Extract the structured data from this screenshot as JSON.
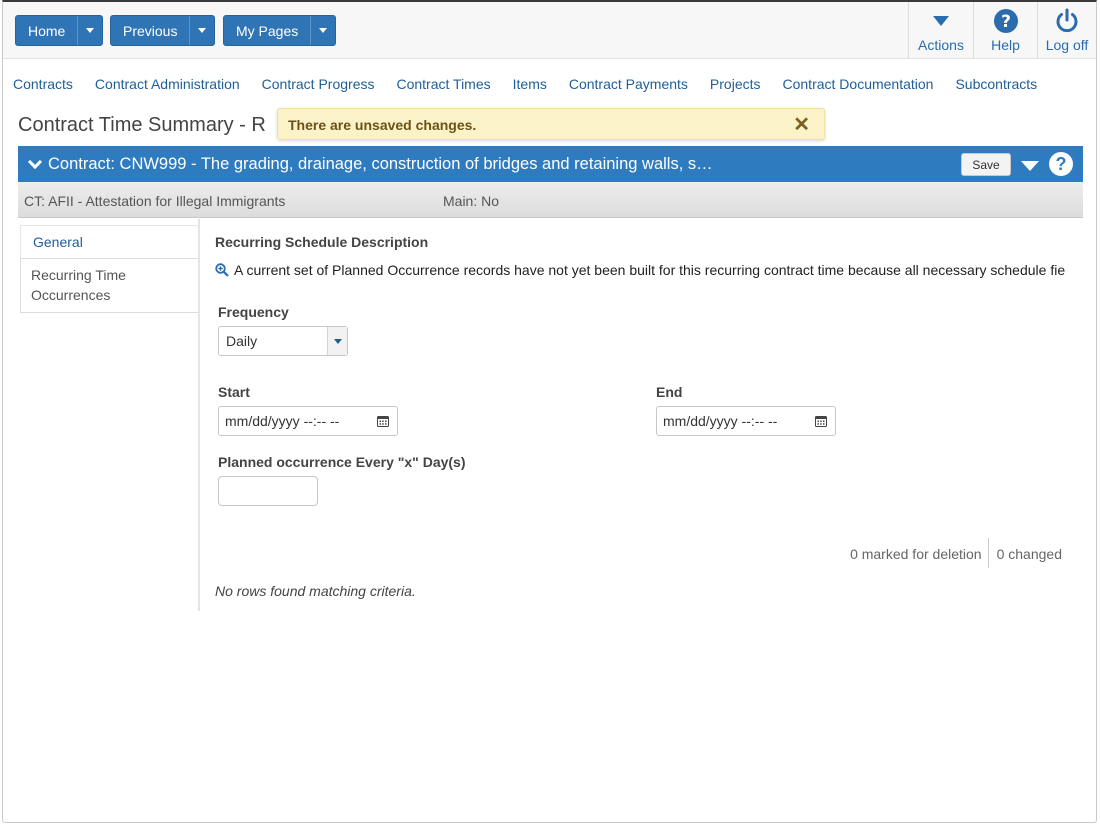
{
  "topbar": {
    "buttons": [
      {
        "label": "Home"
      },
      {
        "label": "Previous"
      },
      {
        "label": "My Pages"
      }
    ],
    "right": [
      {
        "label": "Actions",
        "icon": "caret-down-icon"
      },
      {
        "label": "Help",
        "icon": "help-icon"
      },
      {
        "label": "Log off",
        "icon": "power-icon"
      }
    ]
  },
  "menu": [
    "Contracts",
    "Contract Administration",
    "Contract Progress",
    "Contract Times",
    "Items",
    "Contract Payments",
    "Projects",
    "Contract Documentation",
    "Subcontracts"
  ],
  "page_title": "Contract Time Summary - R",
  "toast": {
    "message": "There are unsaved changes.",
    "close": "✕"
  },
  "contract": {
    "title": "Contract: CNW999 - The grading, drainage, construction of bridges and retaining walls, s…",
    "save_label": "Save",
    "help_glyph": "?",
    "ct": "CT: AFII - Attestation for Illegal Immigrants",
    "main": "Main: No"
  },
  "tabs": [
    {
      "label": "General"
    },
    {
      "label": "Recurring Time Occurrences"
    }
  ],
  "form": {
    "section_label": "Recurring Schedule Description",
    "description": "A current set of Planned Occurrence records have not yet been built for this recurring contract time because all necessary schedule fie",
    "frequency_label": "Frequency",
    "frequency_value": "Daily",
    "start_label": "Start",
    "start_placeholder": "mm/dd/yyyy --:-- --",
    "end_label": "End",
    "end_placeholder": "mm/dd/yyyy --:-- --",
    "interval_label": "Planned occurrence Every \"x\" Day(s)",
    "interval_value": ""
  },
  "counts": {
    "deletion": "0 marked for deletion",
    "changed": "0 changed"
  },
  "empty_message": "No rows found matching criteria.",
  "colors": {
    "primary": "#2f74b5",
    "header_bar": "#2f7bc0",
    "toast_bg": "#fcf2c8",
    "link": "#1f5f99"
  }
}
